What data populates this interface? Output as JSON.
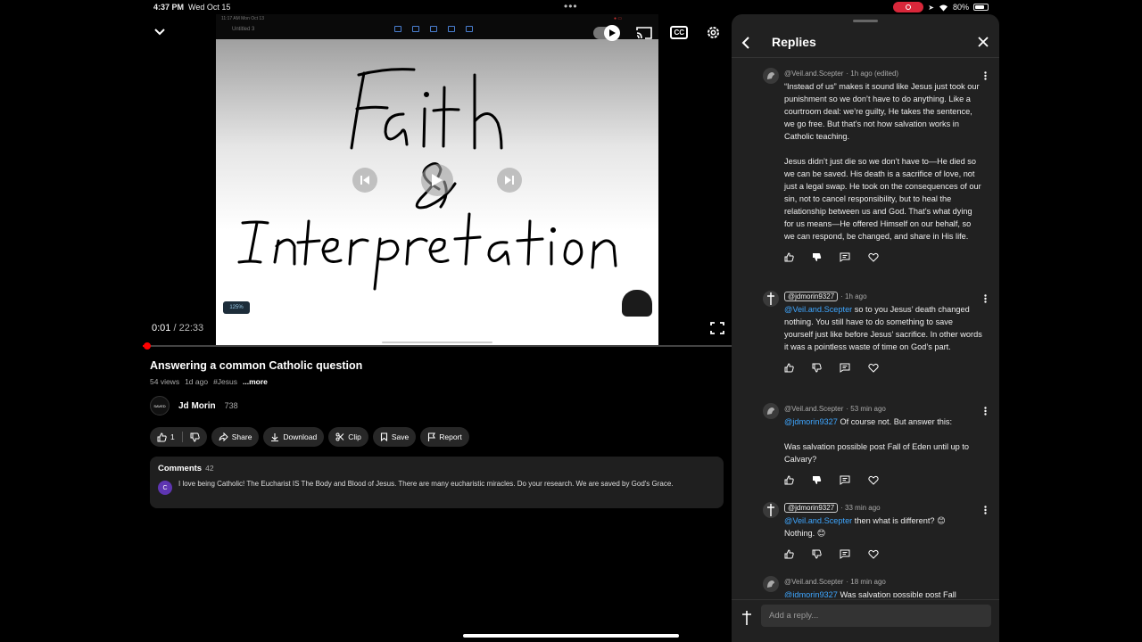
{
  "status_bar": {
    "time": "4:37 PM",
    "date": "Wed Oct 15",
    "battery": "80%"
  },
  "video": {
    "mini_status": "11:17 AM   Mon Oct 13",
    "mini_title": "Untitled 3",
    "handwriting": [
      "Faith",
      "&",
      "Interpretation"
    ],
    "zoom_label": "125%",
    "current_time": "0:01",
    "duration": "22:33",
    "progress_fraction": 0.001,
    "cc_label": "CC"
  },
  "details": {
    "title": "Answering a common Catholic question",
    "views": "54 views",
    "age": "1d ago",
    "hashtag": "#Jesus",
    "more": "...more",
    "channel_name": "Jd Morin",
    "channel_subs": "738",
    "channel_avatar_text": "SAVED"
  },
  "actions": {
    "likes": "1",
    "share": "Share",
    "download": "Download",
    "clip": "Clip",
    "save": "Save",
    "report": "Report"
  },
  "comments": {
    "label": "Comments",
    "count": "42",
    "preview_avatar": "C",
    "preview_text": "I love being Catholic! The Eucharist IS The Body and Blood of Jesus. There are many eucharistic miracles. Do your research. We are saved by God's Grace."
  },
  "replies_panel": {
    "title": "Replies",
    "input_placeholder": "Add a reply...",
    "replies": [
      {
        "author": "@Veil.and.Scepter",
        "time": "· 1h ago (edited)",
        "mention": "",
        "text": "“Instead of us” makes it sound like Jesus just took our punishment so we don’t have to do anything. Like a courtroom deal: we’re guilty, He takes the sentence, we go free. But that’s not how salvation works in Catholic teaching.\n\nJesus didn’t just die so we don’t have to—He died so we can be saved. His death is a sacrifice of love, not just a legal swap. He took on the consequences of our sin, not to cancel responsibility, but to heal the relationship between us and God. That’s what dying for us means—He offered Himself on our behalf, so we can respond, be changed, and share in His life."
      },
      {
        "author": "@jdmorin9327",
        "time": "· 1h ago",
        "mention": "@Veil.and.Scepter",
        "text": " so to you Jesus’ death changed nothing. You still have to do something to save yourself just like before Jesus’ sacrifice. In other words it was a pointless waste of time on God’s part."
      },
      {
        "author": "@Veil.and.Scepter",
        "time": "· 53 min ago",
        "mention": "@jdmorin9327",
        "text": " Of course not. But answer this:\n\nWas salvation possible post Fall of Eden until up to Calvary?"
      },
      {
        "author": "@jdmorin9327",
        "time": "· 33 min ago",
        "mention": "@Veil.and.Scepter",
        "text": " then what is different? 😊\nNothing. 😊"
      },
      {
        "author": "@Veil.and.Scepter",
        "time": "· 18 min ago",
        "mention": "@jdmorin9327",
        "text": " Was salvation possible post Fall"
      }
    ]
  },
  "colors": {
    "accent_red": "#ff0000",
    "mention_blue": "#3ea6ff",
    "panel_bg": "#212121",
    "record_pill": "#d8273a"
  }
}
